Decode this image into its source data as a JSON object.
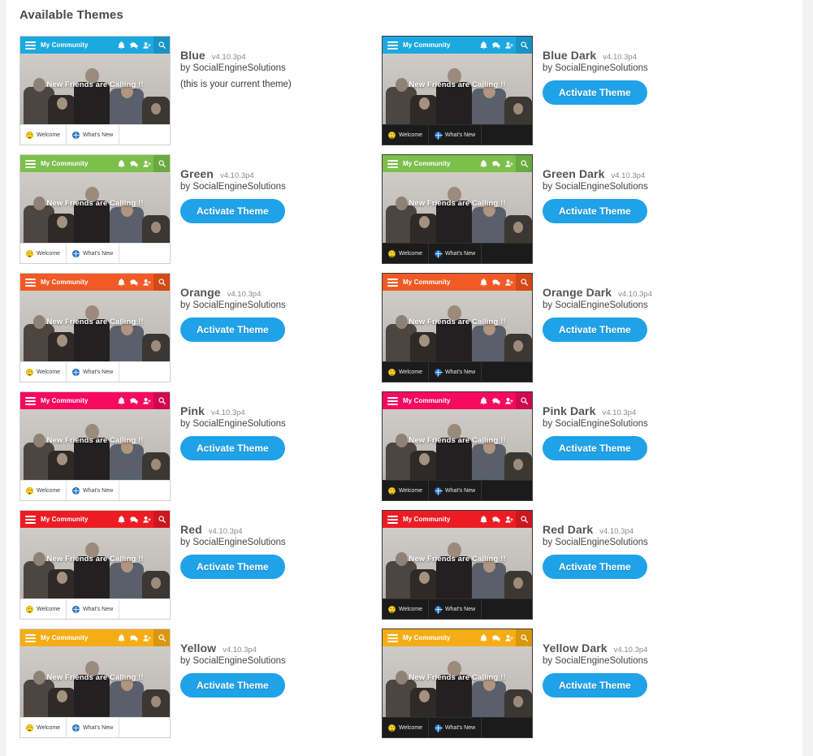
{
  "page": {
    "heading": "Available Themes",
    "background_color": "#f2f2f2",
    "pane_color": "#ffffff"
  },
  "thumbnail_preview": {
    "site_title": "My Community",
    "banner_text": "New Friends are Calling !!",
    "tabs": [
      {
        "label": "Welcome",
        "icon": "smiley-icon"
      },
      {
        "label": "What's New",
        "icon": "globe-icon"
      }
    ],
    "header_icons": [
      "hamburger-icon",
      "bell-icon",
      "chat-icon",
      "add-user-icon",
      "search-icon"
    ]
  },
  "labels": {
    "by_prefix": "by ",
    "activate_button": "Activate Theme",
    "current_theme_note": "(this is your current theme)",
    "accent_button_color": "#1fa2e8"
  },
  "themes": [
    {
      "name": "Blue",
      "version": "v4.10.3p4",
      "author": "SocialEngineSolutions",
      "accent": "#1ca9e0",
      "accent_dark": "#1893c4",
      "dark": false,
      "is_current": true
    },
    {
      "name": "Blue Dark",
      "version": "v4.10.3p4",
      "author": "SocialEngineSolutions",
      "accent": "#1ca9e0",
      "accent_dark": "#1893c4",
      "dark": true,
      "is_current": false
    },
    {
      "name": "Green",
      "version": "v4.10.3p4",
      "author": "SocialEngineSolutions",
      "accent": "#7cbf4b",
      "accent_dark": "#6aa940",
      "dark": false,
      "is_current": false
    },
    {
      "name": "Green Dark",
      "version": "v4.10.3p4",
      "author": "SocialEngineSolutions",
      "accent": "#7cbf4b",
      "accent_dark": "#6aa940",
      "dark": true,
      "is_current": false
    },
    {
      "name": "Orange",
      "version": "v4.10.3p4",
      "author": "SocialEngineSolutions",
      "accent": "#f15a24",
      "accent_dark": "#d14a18",
      "dark": false,
      "is_current": false
    },
    {
      "name": "Orange Dark",
      "version": "v4.10.3p4",
      "author": "SocialEngineSolutions",
      "accent": "#f15a24",
      "accent_dark": "#d14a18",
      "dark": true,
      "is_current": false
    },
    {
      "name": "Pink",
      "version": "v4.10.3p4",
      "author": "SocialEngineSolutions",
      "accent": "#f50a5f",
      "accent_dark": "#d00850",
      "dark": false,
      "is_current": false
    },
    {
      "name": "Pink Dark",
      "version": "v4.10.3p4",
      "author": "SocialEngineSolutions",
      "accent": "#f50a5f",
      "accent_dark": "#d00850",
      "dark": true,
      "is_current": false
    },
    {
      "name": "Red",
      "version": "v4.10.3p4",
      "author": "SocialEngineSolutions",
      "accent": "#ed1c24",
      "accent_dark": "#cc171e",
      "dark": false,
      "is_current": false
    },
    {
      "name": "Red Dark",
      "version": "v4.10.3p4",
      "author": "SocialEngineSolutions",
      "accent": "#ed1c24",
      "accent_dark": "#cc171e",
      "dark": true,
      "is_current": false
    },
    {
      "name": "Yellow",
      "version": "v4.10.3p4",
      "author": "SocialEngineSolutions",
      "accent": "#f5ad17",
      "accent_dark": "#d9970d",
      "dark": false,
      "is_current": false
    },
    {
      "name": "Yellow Dark",
      "version": "v4.10.3p4",
      "author": "SocialEngineSolutions",
      "accent": "#f5ad17",
      "accent_dark": "#d9970d",
      "dark": true,
      "is_current": false
    }
  ]
}
